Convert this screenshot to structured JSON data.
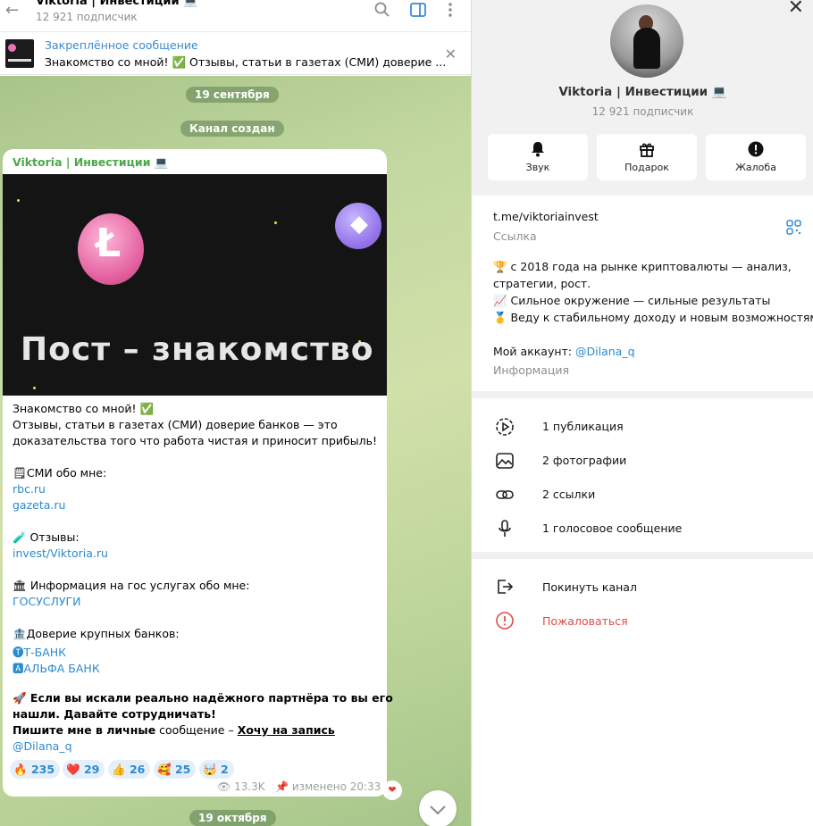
{
  "chat": {
    "header": {
      "title": "Viktoria | Инвестиции 💻",
      "subscribers": "12 921 подписчик"
    },
    "pinned": {
      "title": "Закреплённое сообщение",
      "text": "Знакомство со мной! ✅ Отзывы, статьи в газетах (СМИ) доверие ..."
    },
    "date1": "19 сентября",
    "service": "Канал создан",
    "date2": "19 октября",
    "message": {
      "author": "Viktoria | Инвестиции 💻",
      "image_title": "Пост – знакомство",
      "lines": {
        "l1": "Знакомство со мной! ✅",
        "l2": "Отзывы, статьи в газетах (СМИ) доверие банков — это",
        "l3": "доказательства того что работа чистая и приносит прибыль!",
        "l4": "🗒СМИ обо мне:",
        "l5": "rbc.ru",
        "l6": "gazeta.ru",
        "l7": "🧪 Отзывы:",
        "l8": "invest/Viktoria.ru",
        "l9": "🏛 Информация на гос услугах обо мне:",
        "l10": "ГОСУСЛУГИ",
        "l11": "🏦Доверие крупных банков:",
        "l12": "🅣Т-БАНК",
        "l13": "🅰АЛЬФА БАНК",
        "l14": "🚀 Если вы искали реально надёжного партнёра то вы его",
        "l15": "нашли. Давайте сотрудничать!",
        "l16a": "Пишите мне в личные",
        "l16b": " сообщение – ",
        "l16c": "Хочу на запись",
        "l17": "@Dilana_q"
      },
      "reactions": [
        {
          "emoji": "🔥",
          "count": "235"
        },
        {
          "emoji": "❤️",
          "count": "29"
        },
        {
          "emoji": "👍",
          "count": "26"
        },
        {
          "emoji": "🥰",
          "count": "25"
        },
        {
          "emoji": "🤯",
          "count": "2"
        }
      ],
      "views": "13.3K",
      "edited": "изменено 20:33"
    }
  },
  "info": {
    "name": "Viktoria | Инвестиции 💻",
    "subscribers": "12 921 подписчик",
    "actions": {
      "sound": "Звук",
      "gift": "Подарок",
      "report": "Жалоба"
    },
    "link": {
      "value": "t.me/viktoriainvest",
      "label": "Ссылка"
    },
    "description": {
      "d1": "🏆 с 2018 года на рынке криптовалюты — анализ,",
      "d2": "стратегии, рост.",
      "d3": "📈 Сильное окружение — сильные результаты",
      "d4": "🥇 Веду к стабильному доходу и новым возможностям.",
      "d5a": "Мой аккаунт: ",
      "d5b": "@Dilana_q",
      "label": "Информация"
    },
    "media": {
      "posts": "1 публикация",
      "photos": "2 фотографии",
      "links": "2 ссылки",
      "voice": "1 голосовое сообщение"
    },
    "leave": "Покинуть канал",
    "report": "Пожаловаться"
  }
}
